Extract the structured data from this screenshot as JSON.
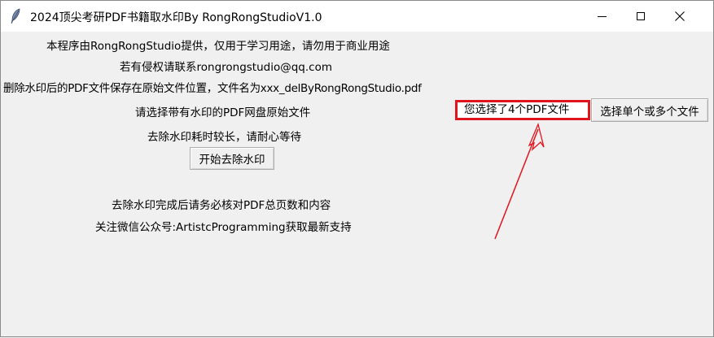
{
  "window": {
    "title": "2024顶尖考研PDF书籍取水印By RongRongStudioV1.0"
  },
  "labels": {
    "line1": "本程序由RongRongStudio提供，仅用于学习用途，请勿用于商业用途",
    "line2": "若有侵权请联系rongrongstudio@qq.com",
    "line3": "删除水印后的PDF文件保存在原始文件位置，文件名为xxx_delByRongRongStudio.pdf",
    "select_prompt": "请选择带有水印的PDF网盘原始文件",
    "wait_note": "去除水印耗时较长，请耐心等待",
    "verify_note": "去除水印完成后请务必核对PDF总页数和内容",
    "follow_note": "关注微信公众号:ArtistcProgramming获取最新支持"
  },
  "file_field": {
    "value": "您选择了4个PDF文件"
  },
  "buttons": {
    "select_files": "选择单个或多个文件",
    "start": "开始去除水印"
  },
  "colors": {
    "highlight": "#e0141d"
  }
}
